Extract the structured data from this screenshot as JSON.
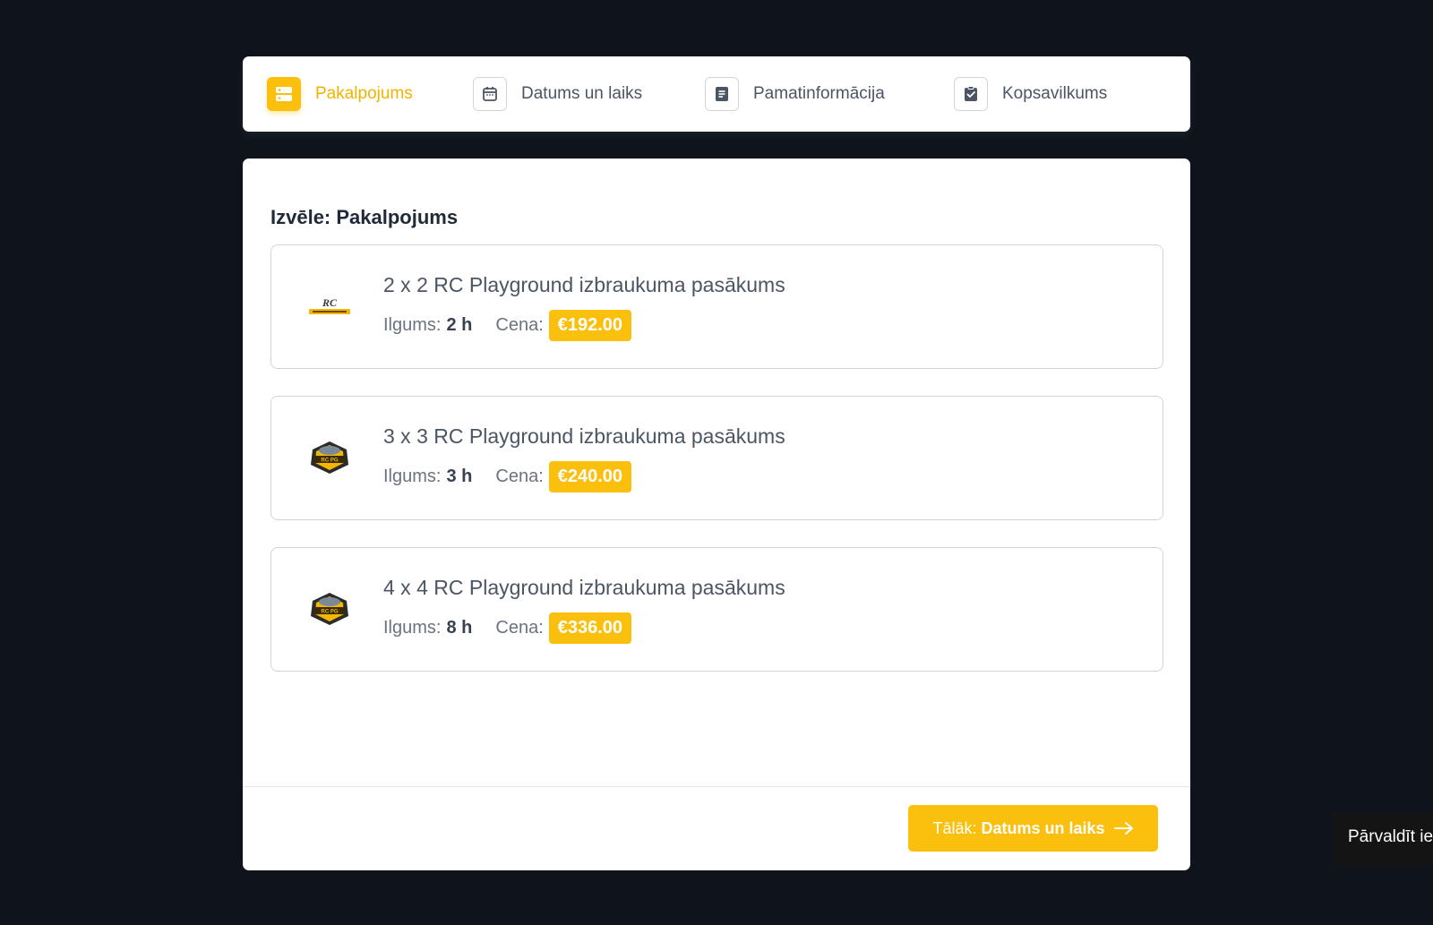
{
  "steps": [
    {
      "label": "Pakalpojums",
      "icon": "server-icon",
      "active": true
    },
    {
      "label": "Datums un laiks",
      "icon": "calendar-icon",
      "active": false
    },
    {
      "label": "Pamatinformācija",
      "icon": "document-icon",
      "active": false
    },
    {
      "label": "Kopsavilkums",
      "icon": "clipboard-check-icon",
      "active": false
    }
  ],
  "main": {
    "title": "Izvēle: Pakalpojums",
    "services": [
      {
        "name": "2 x 2 RC Playground izbraukuma pasākums",
        "duration_label": "Ilgums:",
        "duration_value": "2 h",
        "price_label": "Cena:",
        "price": "€192.00",
        "logo": "rc-playground-logo",
        "logo_text": "RC PLAYGROUND"
      },
      {
        "name": "3 x 3 RC Playground izbraukuma pasākums",
        "duration_label": "Ilgums:",
        "duration_value": "3 h",
        "price_label": "Cena:",
        "price": "€240.00",
        "logo": "rc-playground-badge-logo",
        "logo_text": "RC PLAYGROUND"
      },
      {
        "name": "4 x 4 RC Playground izbraukuma pasākums",
        "duration_label": "Ilgums:",
        "duration_value": "8 h",
        "price_label": "Cena:",
        "price": "€336.00",
        "logo": "rc-playground-badge-logo",
        "logo_text": "RC PLAYGROUND"
      }
    ]
  },
  "footer": {
    "next_prefix": "Tālāk:",
    "next_target": "Datums un laiks"
  },
  "manage_tab": {
    "label": "Pārvaldīt ie"
  },
  "colors": {
    "background": "#0f131c",
    "accent": "#fbbf0d",
    "card_border": "#d1d5db",
    "text": "#4b5563"
  }
}
